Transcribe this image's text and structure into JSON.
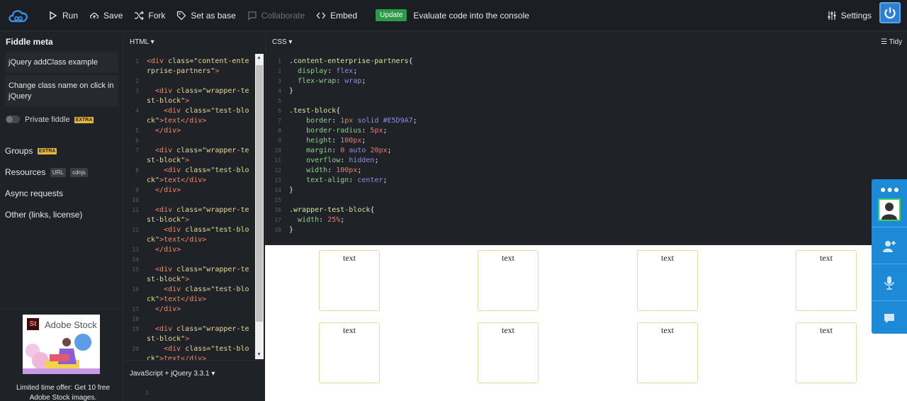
{
  "toolbar": {
    "run": "Run",
    "save": "Save",
    "fork": "Fork",
    "set_as_base": "Set as base",
    "collaborate": "Collaborate",
    "embed": "Embed",
    "update_badge": "Update",
    "update_message": "Evaluate code into the console",
    "settings": "Settings"
  },
  "sidebar": {
    "title": "Fiddle meta",
    "fiddle_title": "jQuery addClass example",
    "fiddle_description": "Change class name on click in jQuery",
    "private_label": "Private fiddle",
    "extra_badge": "EXTRA",
    "groups": "Groups",
    "resources": "Resources",
    "resources_url": "URL",
    "resources_cdnjs": "cdnjs",
    "async_requests": "Async requests",
    "other": "Other (links, license)",
    "ad_brand": "Adobe Stock",
    "ad_logo": "St",
    "ad_text": "Limited time offer: Get 10 free Adobe Stock images."
  },
  "panels": {
    "html_label": "HTML",
    "css_label": "CSS",
    "tidy": "Tidy",
    "js_label": "JavaScript + jQuery 3.3.1",
    "js_line": "1"
  },
  "html_code": {
    "lines": [
      [
        "1",
        "<div",
        " class=",
        "\"content-ente"
      ],
      [
        "",
        "rprise-partners\"",
        ">",
        ""
      ],
      [
        "2",
        "",
        "",
        ""
      ],
      [
        "3",
        "  <div",
        " class=",
        "\"wrapper-te"
      ],
      [
        "",
        "st-block\"",
        ">",
        ""
      ],
      [
        "4",
        "    <div",
        " class=",
        "\"test-blo"
      ],
      [
        "",
        "ck\"",
        ">text</div>",
        ""
      ],
      [
        "5",
        "  </div>",
        "",
        ""
      ],
      [
        "6",
        "",
        "",
        ""
      ],
      [
        "7",
        "  <div",
        " class=",
        "\"wrapper-te"
      ],
      [
        "",
        "st-block\"",
        ">",
        ""
      ],
      [
        "8",
        "    <div",
        " class=",
        "\"test-blo"
      ],
      [
        "",
        "ck\"",
        ">text</div>",
        ""
      ],
      [
        "9",
        "  </div>",
        "",
        ""
      ],
      [
        "10",
        "",
        "",
        ""
      ],
      [
        "11",
        "  <div",
        " class=",
        "\"wrapper-te"
      ],
      [
        "",
        "st-block\"",
        ">",
        ""
      ],
      [
        "12",
        "    <div",
        " class=",
        "\"test-blo"
      ],
      [
        "",
        "ck\"",
        ">text</div>",
        ""
      ],
      [
        "13",
        "  </div>",
        "",
        ""
      ],
      [
        "14",
        "",
        "",
        ""
      ],
      [
        "15",
        "  <div",
        " class=",
        "\"wrapper-te"
      ],
      [
        "",
        "st-block\"",
        ">",
        ""
      ],
      [
        "16",
        "    <div",
        " class=",
        "\"test-blo"
      ],
      [
        "",
        "ck\"",
        ">text</div>",
        ""
      ],
      [
        "17",
        "  </div>",
        "",
        ""
      ],
      [
        "18",
        "",
        "",
        ""
      ],
      [
        "19",
        "  <div",
        " class=",
        "\"wrapper-te"
      ],
      [
        "",
        "st-block\"",
        ">",
        ""
      ],
      [
        "20",
        "    <div",
        " class=",
        "\"test-blo"
      ],
      [
        "",
        "ck\"",
        ">text</div>",
        ""
      ]
    ]
  },
  "css_code": {
    "lines": [
      {
        "n": "1",
        "parts": [
          [
            "sel",
            ".content-enterprise-partners"
          ],
          [
            "punc",
            "{"
          ]
        ]
      },
      {
        "n": "2",
        "parts": [
          [
            "punc",
            "  "
          ],
          [
            "prop",
            "display"
          ],
          [
            "punc",
            ": "
          ],
          [
            "val",
            "flex"
          ],
          [
            "punc",
            ";"
          ]
        ]
      },
      {
        "n": "3",
        "parts": [
          [
            "punc",
            "  "
          ],
          [
            "prop",
            "flex-wrap"
          ],
          [
            "punc",
            ": "
          ],
          [
            "val",
            "wrap"
          ],
          [
            "punc",
            ";"
          ]
        ]
      },
      {
        "n": "4",
        "parts": [
          [
            "punc",
            "}"
          ]
        ]
      },
      {
        "n": "5",
        "parts": []
      },
      {
        "n": "6",
        "parts": [
          [
            "sel",
            ".test-block"
          ],
          [
            "punc",
            "{"
          ]
        ]
      },
      {
        "n": "7",
        "parts": [
          [
            "punc",
            "    "
          ],
          [
            "prop",
            "border"
          ],
          [
            "punc",
            ": "
          ],
          [
            "num",
            "1px"
          ],
          [
            "punc",
            " "
          ],
          [
            "val",
            "solid"
          ],
          [
            "punc",
            " "
          ],
          [
            "val",
            "#E5D9A7"
          ],
          [
            "punc",
            ";"
          ]
        ]
      },
      {
        "n": "8",
        "parts": [
          [
            "punc",
            "    "
          ],
          [
            "prop",
            "border-radius"
          ],
          [
            "punc",
            ": "
          ],
          [
            "num",
            "5px"
          ],
          [
            "punc",
            ";"
          ]
        ]
      },
      {
        "n": "9",
        "parts": [
          [
            "punc",
            "    "
          ],
          [
            "prop",
            "height"
          ],
          [
            "punc",
            ": "
          ],
          [
            "num",
            "100px"
          ],
          [
            "punc",
            ";"
          ]
        ]
      },
      {
        "n": "10",
        "parts": [
          [
            "punc",
            "    "
          ],
          [
            "prop",
            "margin"
          ],
          [
            "punc",
            ": "
          ],
          [
            "num",
            "0"
          ],
          [
            "punc",
            " "
          ],
          [
            "val",
            "auto"
          ],
          [
            "punc",
            " "
          ],
          [
            "num",
            "20px"
          ],
          [
            "punc",
            ";"
          ]
        ]
      },
      {
        "n": "11",
        "parts": [
          [
            "punc",
            "    "
          ],
          [
            "prop",
            "overflow"
          ],
          [
            "punc",
            ": "
          ],
          [
            "val",
            "hidden"
          ],
          [
            "punc",
            ";"
          ]
        ]
      },
      {
        "n": "12",
        "parts": [
          [
            "punc",
            "    "
          ],
          [
            "prop",
            "width"
          ],
          [
            "punc",
            ": "
          ],
          [
            "num",
            "100px"
          ],
          [
            "punc",
            ";"
          ]
        ]
      },
      {
        "n": "13",
        "parts": [
          [
            "punc",
            "    "
          ],
          [
            "prop",
            "text-align"
          ],
          [
            "punc",
            ": "
          ],
          [
            "val",
            "center"
          ],
          [
            "punc",
            ";"
          ]
        ]
      },
      {
        "n": "14",
        "parts": [
          [
            "punc",
            "}"
          ]
        ]
      },
      {
        "n": "15",
        "parts": []
      },
      {
        "n": "16",
        "parts": [
          [
            "sel",
            ".wrapper-test-block"
          ],
          [
            "punc",
            "{"
          ]
        ]
      },
      {
        "n": "17",
        "parts": [
          [
            "punc",
            "  "
          ],
          [
            "prop",
            "width"
          ],
          [
            "punc",
            ": "
          ],
          [
            "num",
            "25%"
          ],
          [
            "punc",
            ";"
          ]
        ]
      },
      {
        "n": "18",
        "parts": [
          [
            "punc",
            "}"
          ]
        ]
      }
    ]
  },
  "result": {
    "block_text": "text",
    "rows": 2,
    "columns": 4
  },
  "colors": {
    "update_green": "#2c9a49",
    "accent_blue": "#2c7fd1",
    "block_border": "#e5d9a7",
    "extra_yellow": "#e8b93c",
    "widget_blue": "#1c8ad6"
  }
}
